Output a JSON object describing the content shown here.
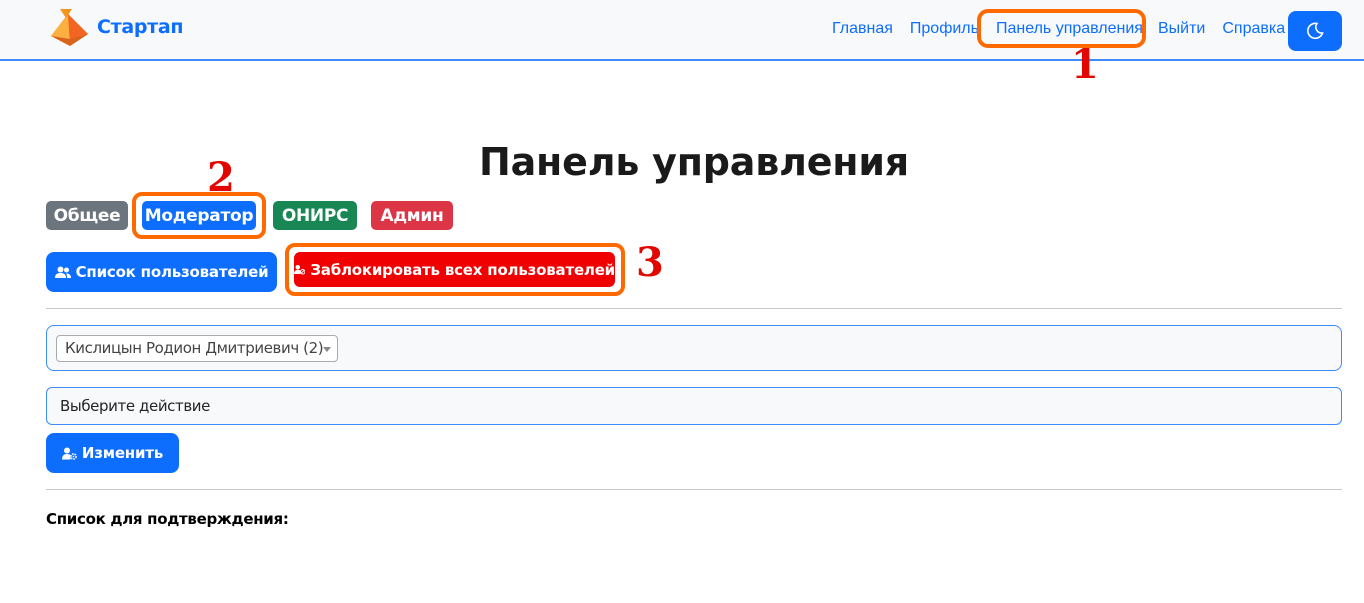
{
  "app": {
    "brand_name": "Стартап",
    "accent_color": "#0d6efd"
  },
  "nav": {
    "items": [
      {
        "label": "Главная"
      },
      {
        "label": "Профиль"
      },
      {
        "label": "Панель управления"
      },
      {
        "label": "Выйти"
      },
      {
        "label": "Справка"
      }
    ],
    "theme_toggle_icon": "moon-icon"
  },
  "page": {
    "title": "Панель управления"
  },
  "role_tabs": [
    {
      "label": "Общее",
      "color": "#6c757d"
    },
    {
      "label": "Модератор",
      "color": "#0d6efd"
    },
    {
      "label": "ОНИРС",
      "color": "#198754"
    },
    {
      "label": "Админ",
      "color": "#dc3545"
    }
  ],
  "actions": {
    "user_list_label": "Список пользователей",
    "user_list_icon": "users-icon",
    "block_all_label": "Заблокировать всех пользователей",
    "block_all_icon": "user-block-icon"
  },
  "form": {
    "user_select_value": "Кислицын Родион Дмитриевич (2)",
    "action_value": "Выберите действие",
    "submit_label": "Изменить",
    "submit_icon": "user-gear-icon"
  },
  "confirmation": {
    "label": "Список для подтверждения:"
  },
  "annotations": {
    "step1": "1",
    "step2": "2",
    "step3": "3",
    "highlight_color": "#ff6a00",
    "number_color": "#e10600"
  }
}
